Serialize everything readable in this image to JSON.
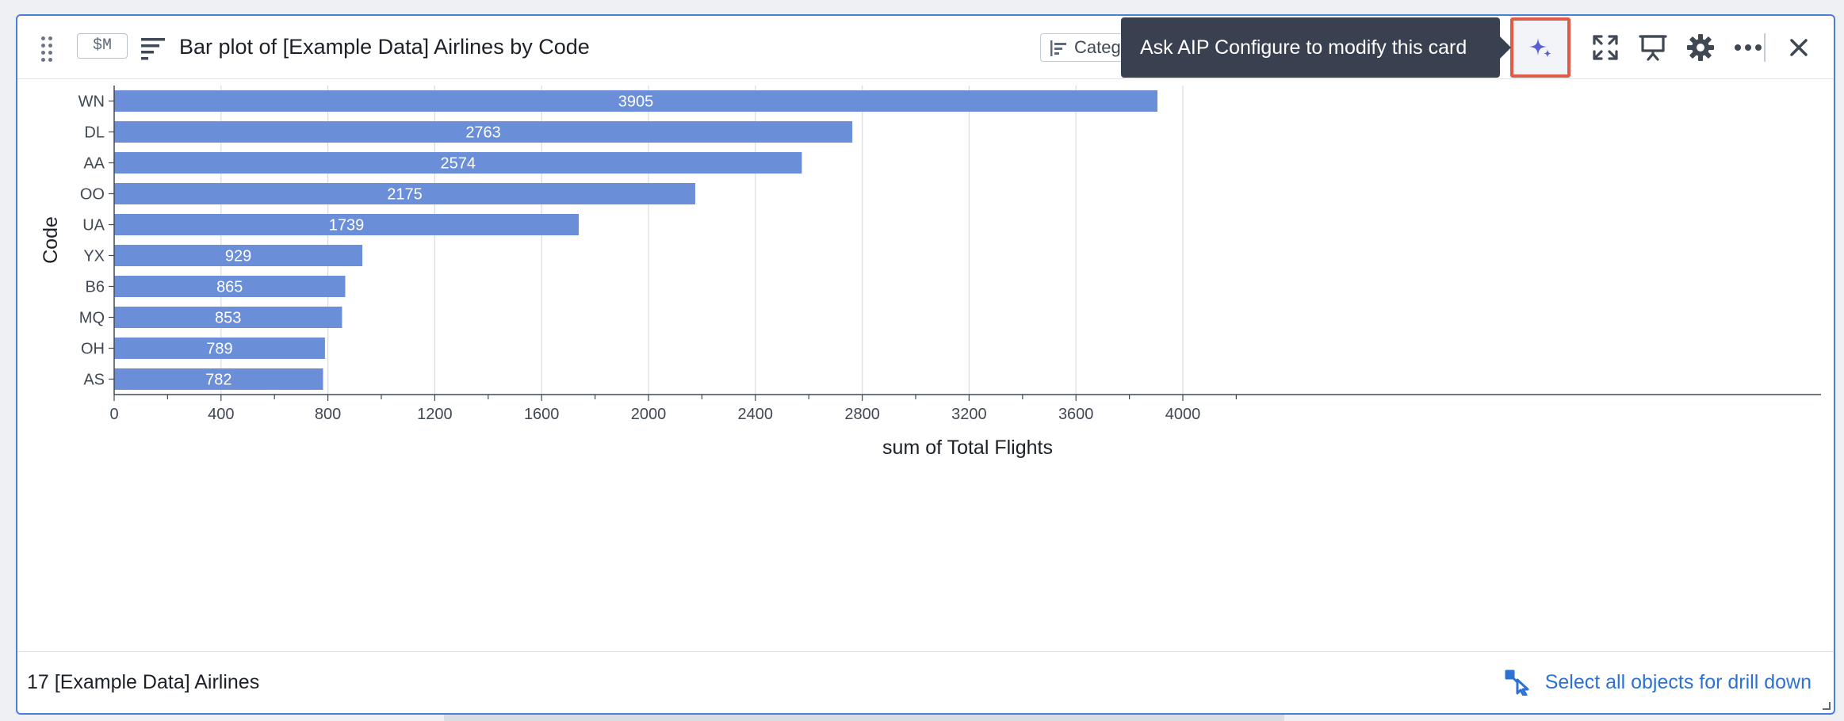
{
  "card": {
    "param_badge": "$M",
    "title": "Bar plot of [Example Data] Airlines by Code",
    "category_button_label": "Categ",
    "tooltip": "Ask AIP Configure to modify this card"
  },
  "footer": {
    "count_text": "17 [Example Data] Airlines",
    "drill_down_label": "Select all objects for drill down"
  },
  "colors": {
    "bar": "#6a8fd8",
    "accent": "#2d72d2",
    "aip_highlight": "#e05b4a",
    "tooltip_bg": "#394150"
  },
  "icons": [
    "drag-handle-icon",
    "sort-icon",
    "category-icon",
    "sparkle-icon",
    "fullscreen-icon",
    "presentation-icon",
    "gear-icon",
    "more-icon",
    "close-icon",
    "drill-down-icon"
  ],
  "chart_data": {
    "type": "bar",
    "orientation": "horizontal",
    "categories": [
      "WN",
      "DL",
      "AA",
      "OO",
      "UA",
      "YX",
      "B6",
      "MQ",
      "OH",
      "AS"
    ],
    "values": [
      3905,
      2763,
      2574,
      2175,
      1739,
      929,
      865,
      853,
      789,
      782
    ],
    "xlabel": "sum of Total Flights",
    "ylabel": "Code",
    "xlim": [
      0,
      4300
    ],
    "xticks": [
      0,
      400,
      800,
      1200,
      1600,
      2000,
      2400,
      2800,
      3200,
      3600,
      4000
    ],
    "grid": true,
    "data_labels": true
  }
}
